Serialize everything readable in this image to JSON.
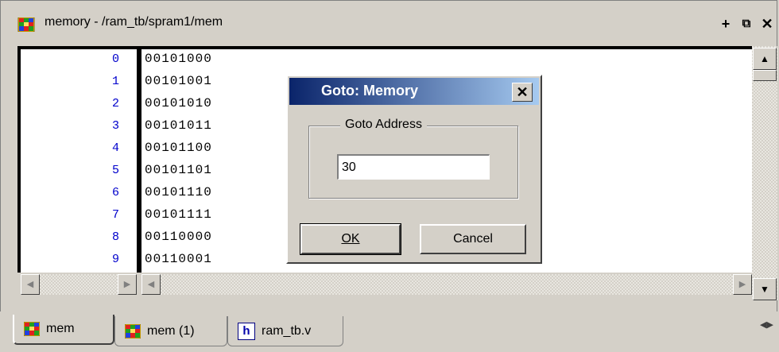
{
  "window": {
    "title": "memory - /ram_tb/spram1/mem",
    "buttons": [
      "+",
      "⧉",
      "✕"
    ]
  },
  "memory": {
    "rows": [
      {
        "addr": "0",
        "value": "00101000"
      },
      {
        "addr": "1",
        "value": "00101001"
      },
      {
        "addr": "2",
        "value": "00101010"
      },
      {
        "addr": "3",
        "value": "00101011"
      },
      {
        "addr": "4",
        "value": "00101100"
      },
      {
        "addr": "5",
        "value": "00101101"
      },
      {
        "addr": "6",
        "value": "00101110"
      },
      {
        "addr": "7",
        "value": "00101111"
      },
      {
        "addr": "8",
        "value": "00110000"
      },
      {
        "addr": "9",
        "value": "00110001"
      }
    ]
  },
  "dialog": {
    "title": "Goto: Memory",
    "close_glyph": "✕",
    "group_label": "Goto Address",
    "address_value": "30",
    "ok_label": "OK",
    "cancel_label": "Cancel"
  },
  "tabs": [
    {
      "label": "mem",
      "icon": "memory-grid-icon",
      "active": true
    },
    {
      "label": "mem (1)",
      "icon": "memory-grid-icon",
      "active": false
    },
    {
      "label": "ram_tb.v",
      "icon": "hdl-file-icon",
      "active": false
    }
  ],
  "colors": {
    "dialog_title_start": "#0a246a",
    "dialog_title_end": "#a6caf0",
    "address_color": "#0000cc"
  }
}
